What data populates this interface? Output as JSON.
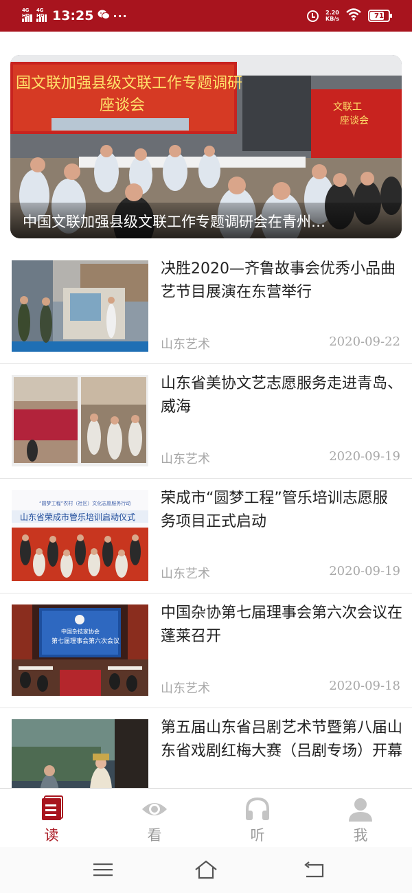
{
  "status_bar": {
    "network_1": "4G HD",
    "network_2": "4G HD",
    "time": "13:25",
    "wechat_icon": "wechat-icon",
    "more_dots": "···",
    "net_speed_value": "2.20",
    "net_speed_unit": "KB/s",
    "battery": "71",
    "bg_color": "#a8141e"
  },
  "hero": {
    "caption": "中国文联加强县级文联工作专题调研会在青州…",
    "screen_text_1": "国文联加强县级文联工作专题调研",
    "screen_text_2": "座谈会",
    "screen_text_3": "文联工",
    "screen_text_4": "座谈会"
  },
  "news": [
    {
      "title": "决胜2020—齐鲁故事会优秀小品曲艺节目展演在东营举行",
      "source": "山东艺术",
      "date": "2020-09-22"
    },
    {
      "title": "山东省美协文艺志愿服务走进青岛、威海",
      "source": "山东艺术",
      "date": "2020-09-19"
    },
    {
      "title": "荣成市“圆梦工程”管乐培训志愿服务项目正式启动",
      "source": "山东艺术",
      "date": "2020-09-19",
      "thumb_banner": "山东省荣成市管乐培训启动仪式",
      "thumb_banner_top": "“圆梦工程”农村（社区）文化志愿服务行动"
    },
    {
      "title": "中国杂协第七届理事会第六次会议在蓬莱召开",
      "source": "山东艺术",
      "date": "2020-09-18",
      "thumb_screen_1": "中国杂技家协会",
      "thumb_screen_2": "第七届理事会第六次会议"
    },
    {
      "title": "第五届山东省吕剧艺术节暨第八届山东省戏剧红梅大赛（吕剧专场）开幕",
      "source": "",
      "date": ""
    }
  ],
  "tabs": [
    {
      "label": "读",
      "icon": "book-icon",
      "active": true
    },
    {
      "label": "看",
      "icon": "eye-icon",
      "active": false
    },
    {
      "label": "听",
      "icon": "headphones-icon",
      "active": false
    },
    {
      "label": "我",
      "icon": "user-icon",
      "active": false
    }
  ],
  "system_nav": [
    "menu-icon",
    "home-icon",
    "back-icon"
  ],
  "colors": {
    "accent": "#a8141e",
    "muted": "#a8a8a8",
    "tab_inactive": "#c4c4c4"
  }
}
